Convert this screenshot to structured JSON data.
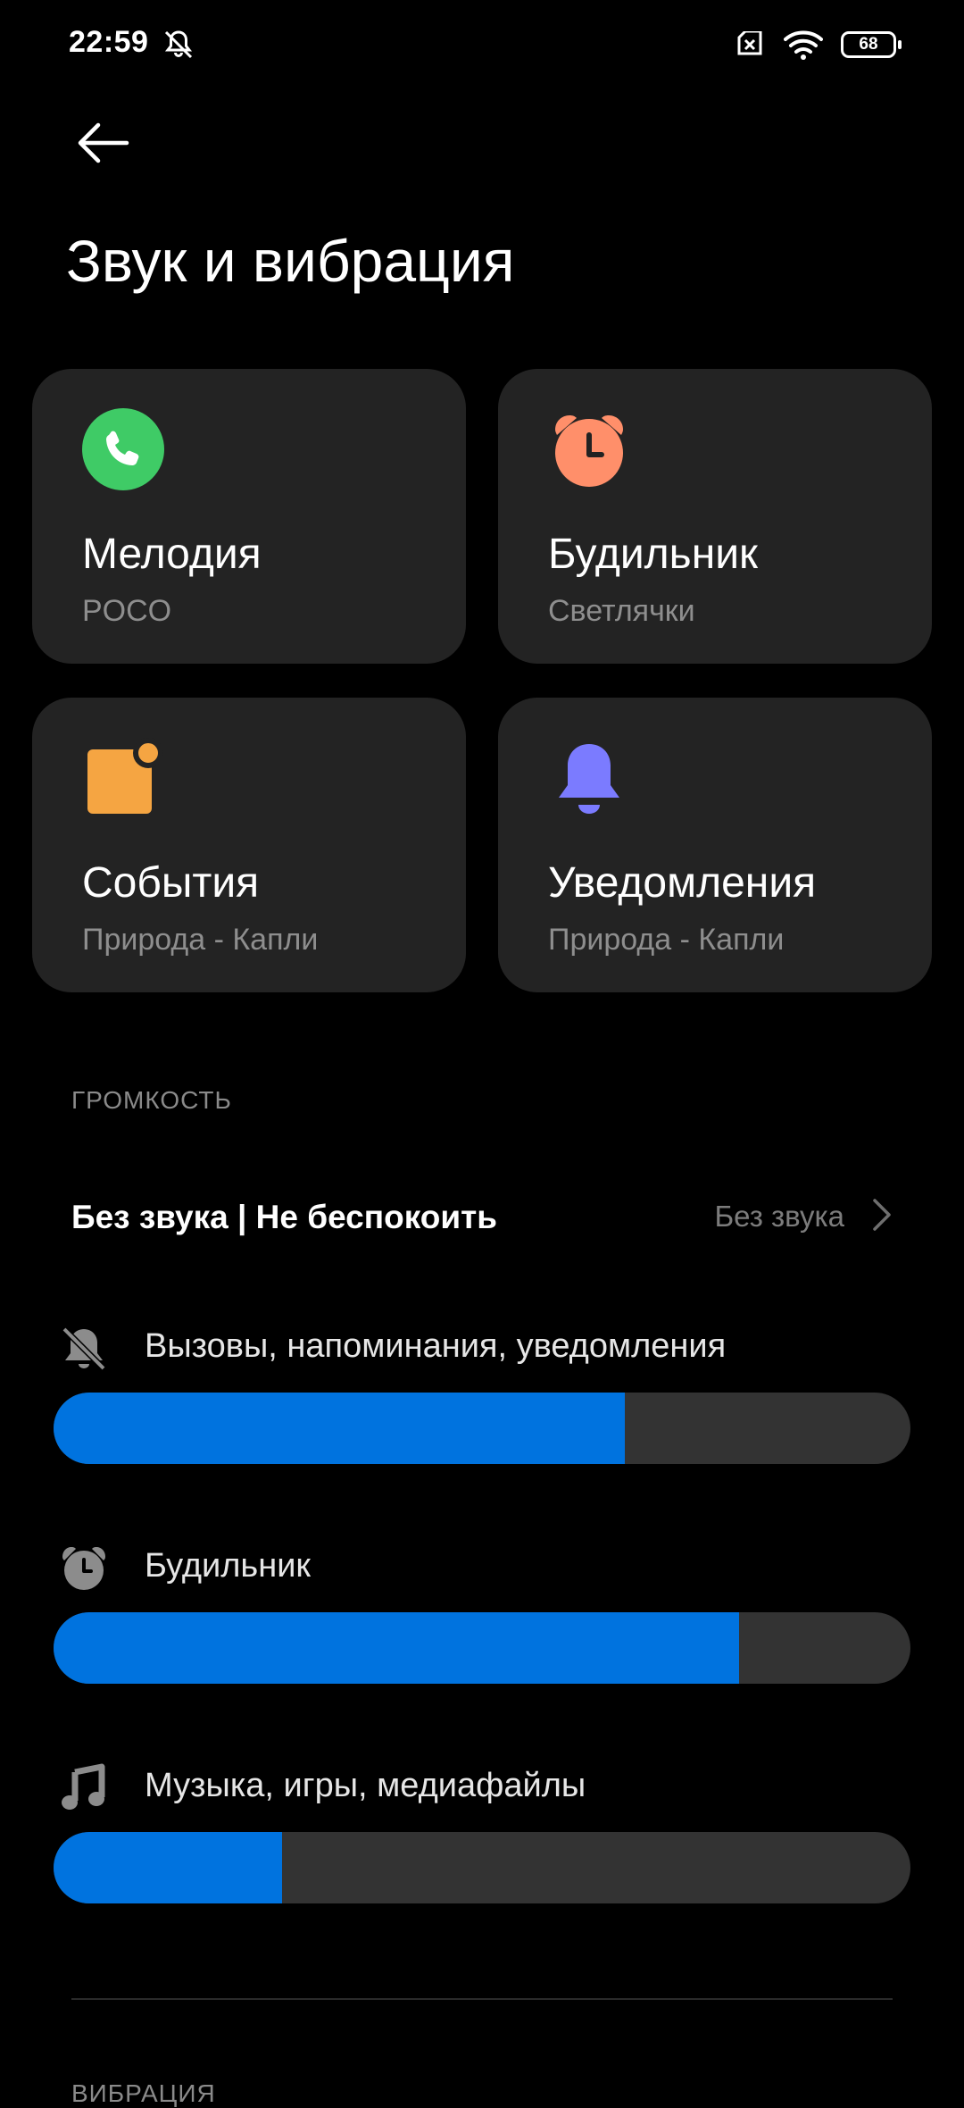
{
  "status_bar": {
    "time": "22:59",
    "battery": "68",
    "battery_level": 0.68
  },
  "header": {
    "title": "Звук и вибрация"
  },
  "cards": [
    {
      "title": "Мелодия",
      "subtitle": "POCO",
      "icon": "phone-icon",
      "color": "#3fcb66"
    },
    {
      "title": "Будильник",
      "subtitle": "Светлячки",
      "icon": "alarm-clock-icon",
      "color": "#ff8f6a"
    },
    {
      "title": "События",
      "subtitle": "Природа - Капли",
      "icon": "calendar-event-icon",
      "color": "#f5a542"
    },
    {
      "title": "Уведомления",
      "subtitle": "Природа - Капли",
      "icon": "bell-icon",
      "color": "#7b7bff"
    }
  ],
  "volume": {
    "section_title": "ГРОМКОСТЬ",
    "dnd": {
      "label": "Без звука | Не беспокоить",
      "value": "Без звука"
    },
    "sliders": [
      {
        "label": "Вызовы, напоминания, уведомления",
        "icon": "bell-muted-icon",
        "level": 0.667
      },
      {
        "label": "Будильник",
        "icon": "alarm-icon",
        "level": 0.8
      },
      {
        "label": "Музыка, игры, медиафайлы",
        "icon": "music-note-icon",
        "level": 0.267
      }
    ],
    "accent_color": "#0073df"
  },
  "vibration": {
    "section_title": "ВИБРАЦИЯ"
  }
}
